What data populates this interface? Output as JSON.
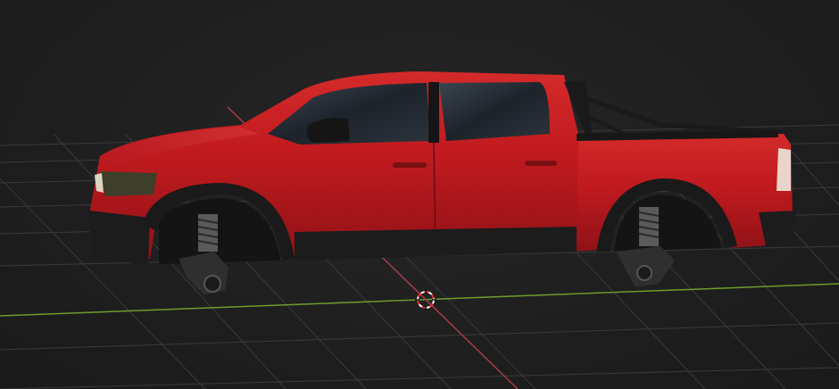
{
  "viewport": {
    "background_color": "#1f1f1f",
    "grid_line_color": "#3a3a3a",
    "x_axis_color": "#6f9a2e",
    "y_axis_color": "#a63a4a",
    "cursor_icon": "3d-cursor-icon",
    "model": {
      "icon": "pickup-truck-model",
      "body_color": "#c4191f",
      "trim_color": "#1c1c1c",
      "glass_color": "#20262c",
      "wheels_present": false,
      "suspension_visible": true
    }
  }
}
